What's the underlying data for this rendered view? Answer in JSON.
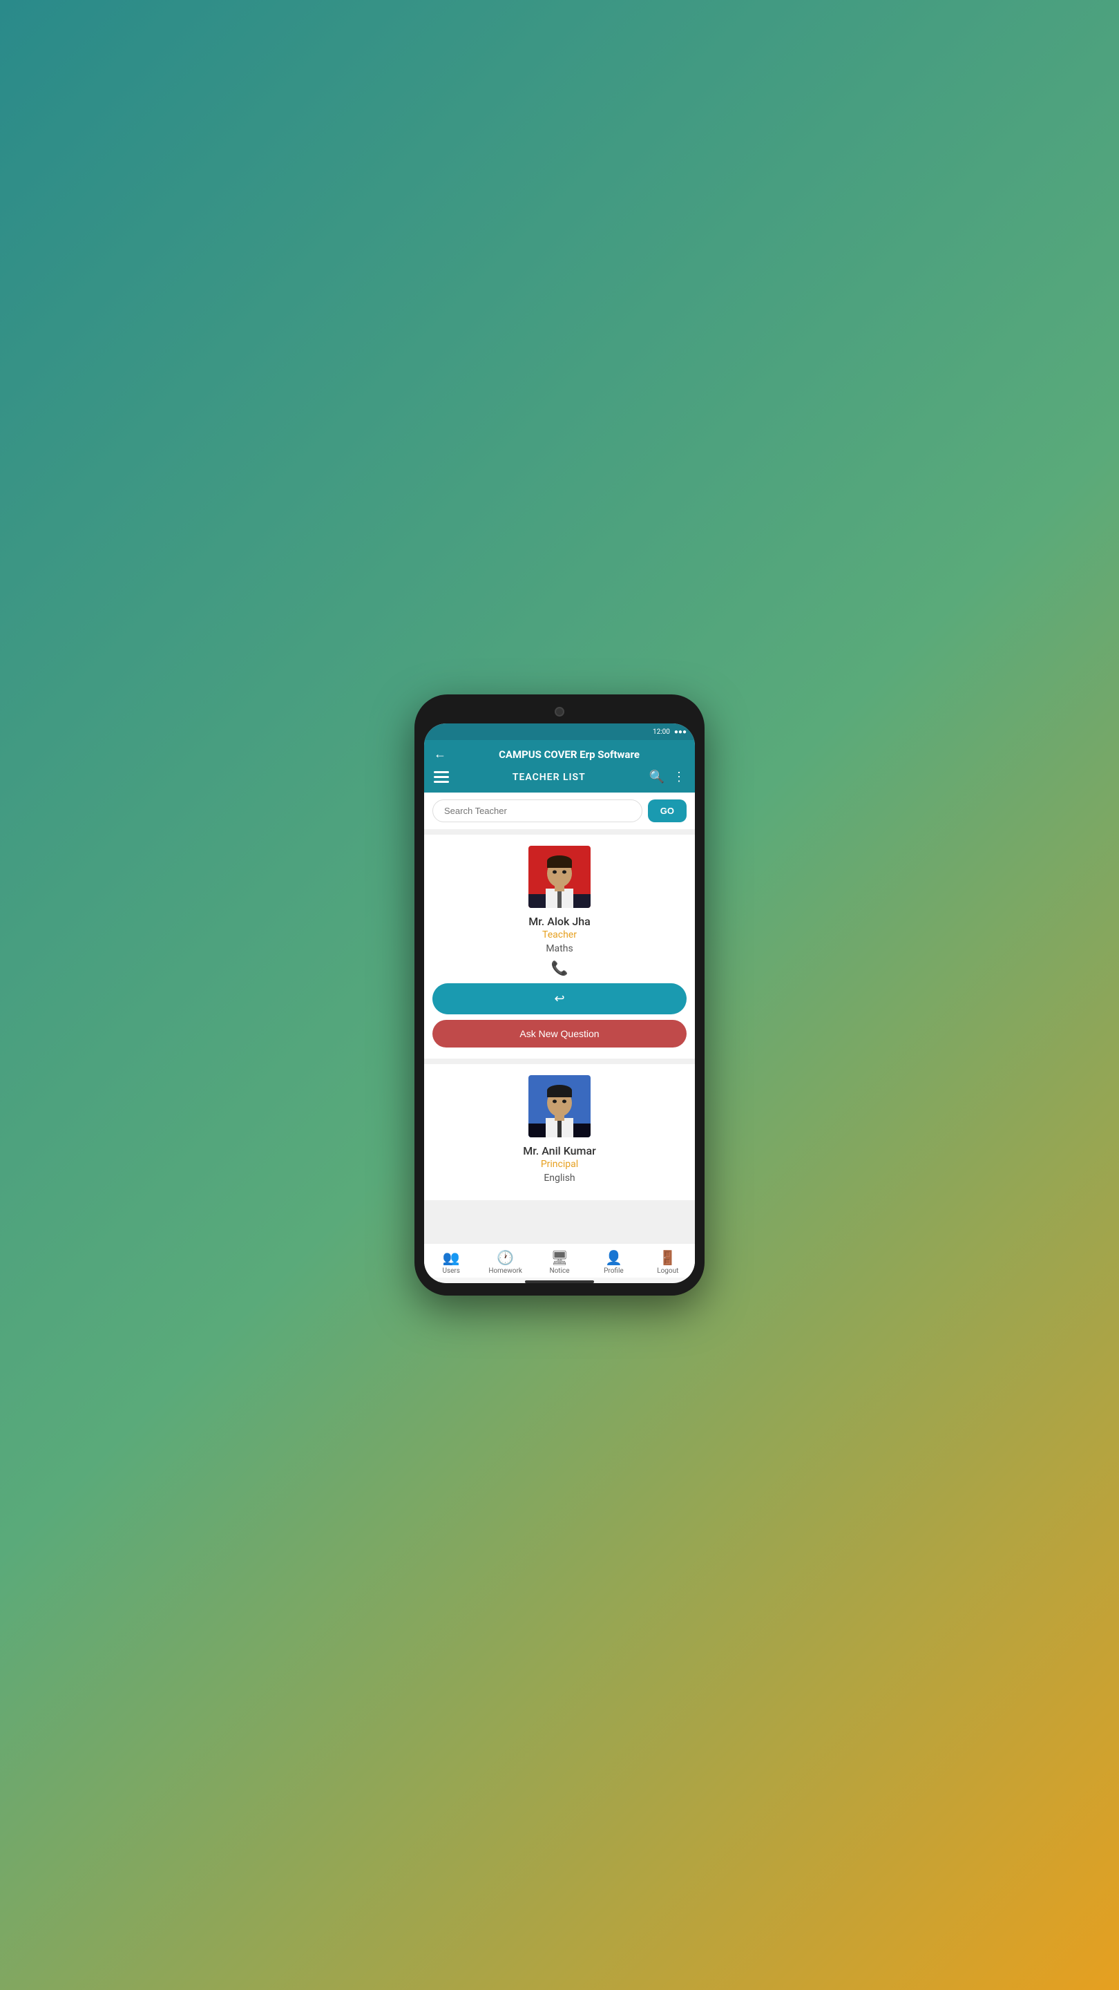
{
  "app": {
    "title": "CAMPUS COVER Erp Software",
    "header_nav_title": "TEACHER LIST"
  },
  "search": {
    "placeholder": "Search Teacher",
    "go_label": "GO"
  },
  "teachers": [
    {
      "name": "Mr. Alok Jha",
      "role": "Teacher",
      "subject": "Maths",
      "avatar_bg": "red",
      "reply_label": "↩",
      "ask_label": "Ask New Question"
    },
    {
      "name": "Mr. Anil Kumar",
      "role": "Principal",
      "subject": "English",
      "avatar_bg": "blue"
    }
  ],
  "bottom_nav": {
    "items": [
      {
        "label": "Users",
        "icon": "👥"
      },
      {
        "label": "Homework",
        "icon": "🕐"
      },
      {
        "label": "Notice",
        "icon": "🖥"
      },
      {
        "label": "Profile",
        "icon": "👤"
      },
      {
        "label": "Logout",
        "icon": "🚪"
      }
    ]
  }
}
